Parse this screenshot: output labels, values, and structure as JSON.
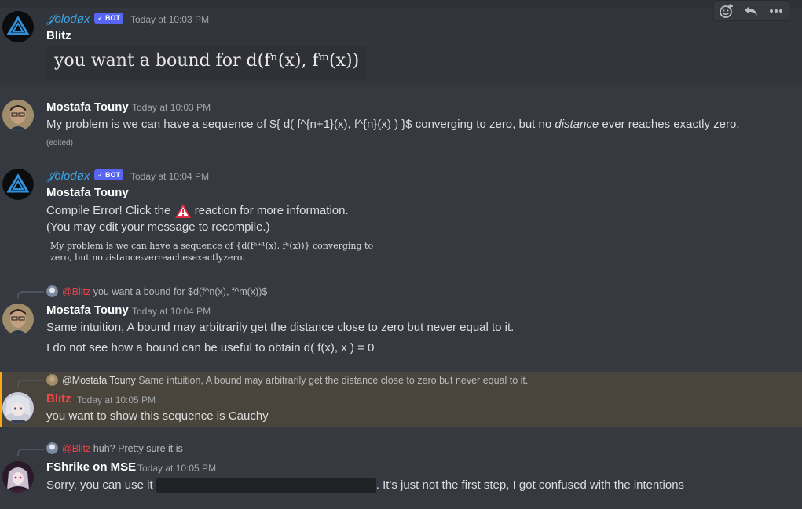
{
  "toolbar": {
    "add_reaction_icon": "add-reaction-icon",
    "reply_icon": "reply-icon",
    "more_icon": "more-icon"
  },
  "messages": [
    {
      "author": "𝒥olodøx",
      "badge": "✓ BOT",
      "timestamp": "Today at 10:03 PM",
      "subtitle": "Blitz",
      "latex": "you want a bound for d(fⁿ(x), fᵐ(x))"
    },
    {
      "author": "Mostafa Touny",
      "timestamp": "Today at 10:03 PM",
      "text_before": "My problem is we can have a sequence of ${ d( f^{n+1}(x), f^{n}(x) ) }$ converging to zero, but no ",
      "text_em": "distance",
      "text_after": " ever reaches exactly zero.",
      "edited": "(edited)"
    },
    {
      "author": "𝒥olodøx",
      "badge": "✓ BOT",
      "timestamp": "Today at 10:04 PM",
      "subtitle": "Mostafa Touny",
      "line1_before": "Compile Error! Click the ",
      "line1_after": " reaction for more information.",
      "line2": "(You may edit your message to recompile.)",
      "latex_line1": "My problem is we can have a sequence of {d(fⁿ⁺¹(x), fⁿ(x))} converging to",
      "latex_line2": "zero, but no ₔistanceₑverreachesexactlyzero."
    },
    {
      "reply_mention": "@Blitz",
      "reply_text": "you want a bound for $d(f^n(x), f^m(x))$",
      "author": "Mostafa Touny",
      "timestamp": "Today at 10:04 PM",
      "line1": "Same intuition, A bound may arbitrarily get the distance close to zero but never equal to it.",
      "line2": "I do not see how a bound can be useful to obtain d( f(x), x ) = 0"
    },
    {
      "reply_author": "@Mostafa Touny",
      "reply_text": "Same intuition, A bound may arbitrarily get the distance close to zero but never equal to it.",
      "author": "Blitz",
      "author_color": "#f04747",
      "timestamp": "Today at 10:05 PM",
      "text": "you want to show this sequence is Cauchy"
    },
    {
      "reply_mention": "@Blitz",
      "reply_text": "huh? Pretty sure it is",
      "author": "FShrike on MSE",
      "timestamp": "Today at 10:05 PM",
      "text_before": "Sorry, you can use it ",
      "text_after": ". It's just not the first step, I got confused with the intentions"
    }
  ]
}
